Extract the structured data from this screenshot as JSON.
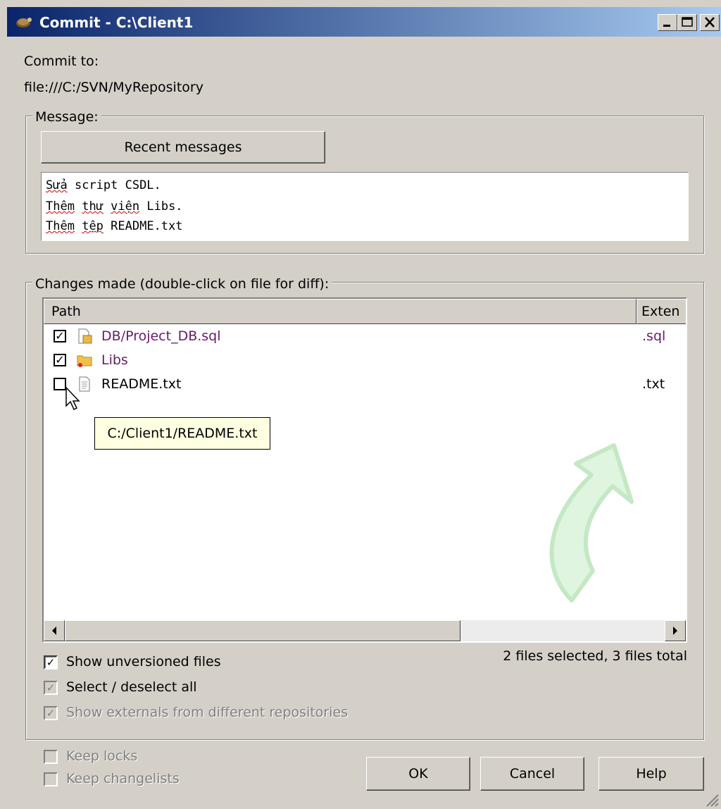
{
  "window": {
    "title": "Commit - C:\\Client1",
    "controls": {
      "minimize": "minimize-icon",
      "maximize": "maximize-icon",
      "close": "close-icon"
    }
  },
  "commit_to": {
    "label": "Commit to:",
    "url": "file:///C:/SVN/MyRepository"
  },
  "message": {
    "group_label": "Message:",
    "recent_button": "Recent messages",
    "lines": [
      {
        "a": "Sửa",
        "b": " script CSDL."
      },
      {
        "a": "Thêm",
        "b": " ",
        "c": "thư",
        "d": " ",
        "e": "viện",
        "f": " Libs."
      },
      {
        "a": "Thêm",
        "b": " ",
        "c": "tệp",
        "d": " README.txt"
      }
    ]
  },
  "changes": {
    "group_label": "Changes made (double-click on file for diff):",
    "columns": {
      "path": "Path",
      "extension": "Exten"
    },
    "files": [
      {
        "path": "DB/Project_DB.sql",
        "ext": ".sql",
        "checked": true,
        "icon": "sql-file-icon"
      },
      {
        "path": "Libs",
        "ext": "",
        "checked": true,
        "icon": "folder-icon"
      },
      {
        "path": "README.txt",
        "ext": ".txt",
        "checked": false,
        "icon": "text-file-icon"
      }
    ],
    "tooltip": "C:/Client1/README.txt",
    "status": "2 files selected, 3 files total",
    "options": {
      "show_unversioned": "Show unversioned files",
      "select_all": "Select / deselect all",
      "show_externals": "Show externals from different repositories"
    }
  },
  "footer": {
    "keep_locks": "Keep locks",
    "keep_changelists": "Keep changelists",
    "ok": "OK",
    "cancel": "Cancel",
    "help": "Help"
  },
  "colors": {
    "title_start": "#0a246a",
    "title_end": "#a6caf0",
    "dialog": "#d4d0c8",
    "added_item": "#6a1a6a",
    "tooltip_bg": "#ffffe1"
  }
}
